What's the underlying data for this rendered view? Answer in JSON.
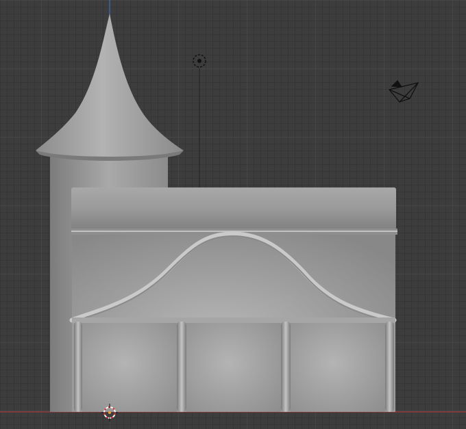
{
  "app": {
    "name": "3D viewport",
    "view": "orthographic-front"
  },
  "scene": {
    "objects": [
      {
        "name": "tower-cone",
        "type": "mesh"
      },
      {
        "name": "tower-cylinder",
        "type": "mesh"
      },
      {
        "name": "building-body",
        "type": "mesh"
      },
      {
        "name": "cornice",
        "type": "mesh"
      },
      {
        "name": "arch-trim",
        "type": "mesh"
      },
      {
        "name": "pillars",
        "type": "mesh"
      }
    ],
    "helpers": {
      "light_icon": "light-icon",
      "camera_icon": "camera-icon",
      "origin_icon": "3d-cursor-icon"
    }
  },
  "colors": {
    "background": "#3d3d3d",
    "grid_minor": "#363636",
    "grid_major": "#464646",
    "axis_x": "#a33a3a",
    "axis_z": "#3b6bc4",
    "mesh_light": "#b8b8b8",
    "mesh_mid": "#9a9a9a",
    "mesh_dark": "#6e6e6e"
  }
}
